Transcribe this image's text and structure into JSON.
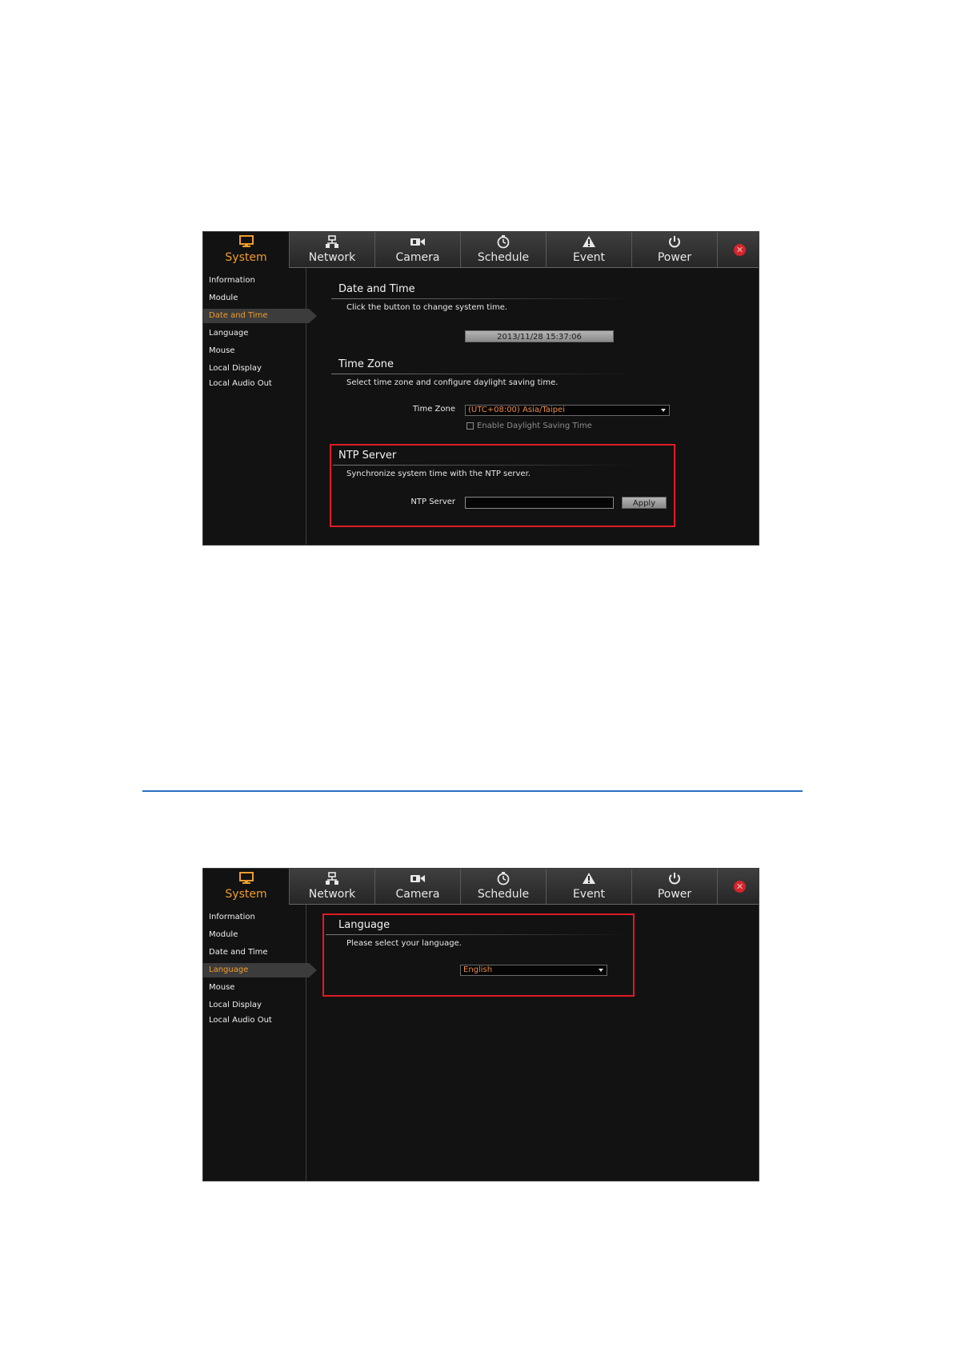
{
  "screens": [
    {
      "tabs": [
        {
          "label": "System",
          "icon": "monitor-icon",
          "active": true
        },
        {
          "label": "Network",
          "icon": "network-icon"
        },
        {
          "label": "Camera",
          "icon": "camera-icon"
        },
        {
          "label": "Schedule",
          "icon": "clock-icon"
        },
        {
          "label": "Event",
          "icon": "warning-icon"
        },
        {
          "label": "Power",
          "icon": "power-icon"
        }
      ],
      "close_icon": "close-icon",
      "sidebar": [
        "Information",
        "Module",
        "Date and Time",
        "Language",
        "Mouse",
        "Local Display",
        "Local Audio Out"
      ],
      "active_sidebar": "Date and Time",
      "date_time": {
        "title": "Date and Time",
        "description": "Click the button to change system time.",
        "button_value": "2013/11/28 15:37:06"
      },
      "time_zone": {
        "title": "Time Zone",
        "description": "Select time zone and configure daylight saving time.",
        "label": "Time Zone",
        "value": "(UTC+08:00) Asia/Taipei",
        "dst_label": "Enable Daylight Saving Time",
        "dst_checked": false
      },
      "ntp": {
        "title": "NTP Server",
        "description": "Synchronize system time with the NTP server.",
        "label": "NTP Server",
        "value": "",
        "apply_label": "Apply"
      }
    },
    {
      "tabs": [
        {
          "label": "System",
          "icon": "monitor-icon",
          "active": true
        },
        {
          "label": "Network",
          "icon": "network-icon"
        },
        {
          "label": "Camera",
          "icon": "camera-icon"
        },
        {
          "label": "Schedule",
          "icon": "clock-icon"
        },
        {
          "label": "Event",
          "icon": "warning-icon"
        },
        {
          "label": "Power",
          "icon": "power-icon"
        }
      ],
      "close_icon": "close-icon",
      "sidebar": [
        "Information",
        "Module",
        "Date and Time",
        "Language",
        "Mouse",
        "Local Display",
        "Local Audio Out"
      ],
      "active_sidebar": "Language",
      "language": {
        "title": "Language",
        "description": "Please select your language.",
        "value": "English"
      }
    }
  ],
  "colors": {
    "accent": "#f19c2c",
    "highlight_box": "#e01b24",
    "separator": "#2a6fc0",
    "panel_bg": "#121212"
  }
}
